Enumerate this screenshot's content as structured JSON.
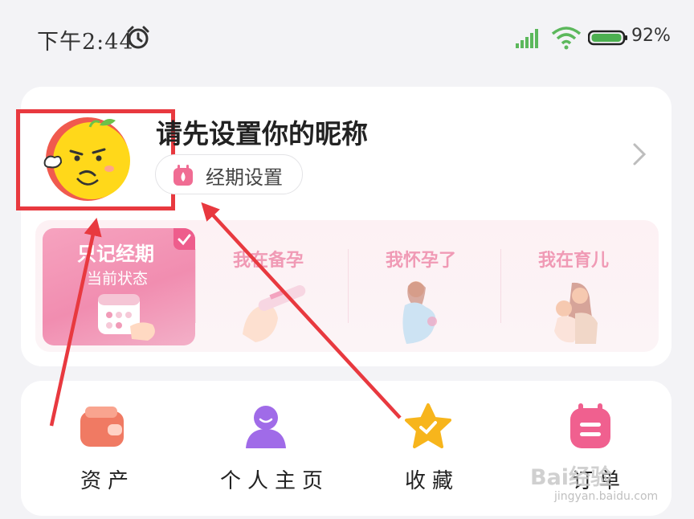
{
  "status_bar": {
    "time": "下午2:44",
    "battery_percent": "92%",
    "icons": [
      "alarm-icon",
      "signal-icon",
      "wifi-icon",
      "battery-icon"
    ]
  },
  "profile": {
    "nickname": "请先设置你的昵称",
    "period_button_label": "经期设置"
  },
  "status_options": [
    {
      "title": "只记经期",
      "subtitle": "当前状态",
      "selected": true
    },
    {
      "title": "我在备孕",
      "selected": false
    },
    {
      "title": "我怀孕了",
      "selected": false
    },
    {
      "title": "我在育儿",
      "selected": false
    }
  ],
  "shortcuts": [
    {
      "label": "资产",
      "icon": "wallet-icon",
      "color": "#f07a63"
    },
    {
      "label": "个人主页",
      "icon": "user-icon",
      "color": "#a06be8"
    },
    {
      "label": "收藏",
      "icon": "star-icon",
      "color": "#f7b51c"
    },
    {
      "label": "订单",
      "icon": "calendar-icon",
      "color": "#f0608f"
    }
  ],
  "watermark": {
    "brand": "Bai经验",
    "url": "jingyan.baidu.com"
  },
  "colors": {
    "accent_pink": "#ee5d8c",
    "annotation_red": "#e8393f"
  }
}
